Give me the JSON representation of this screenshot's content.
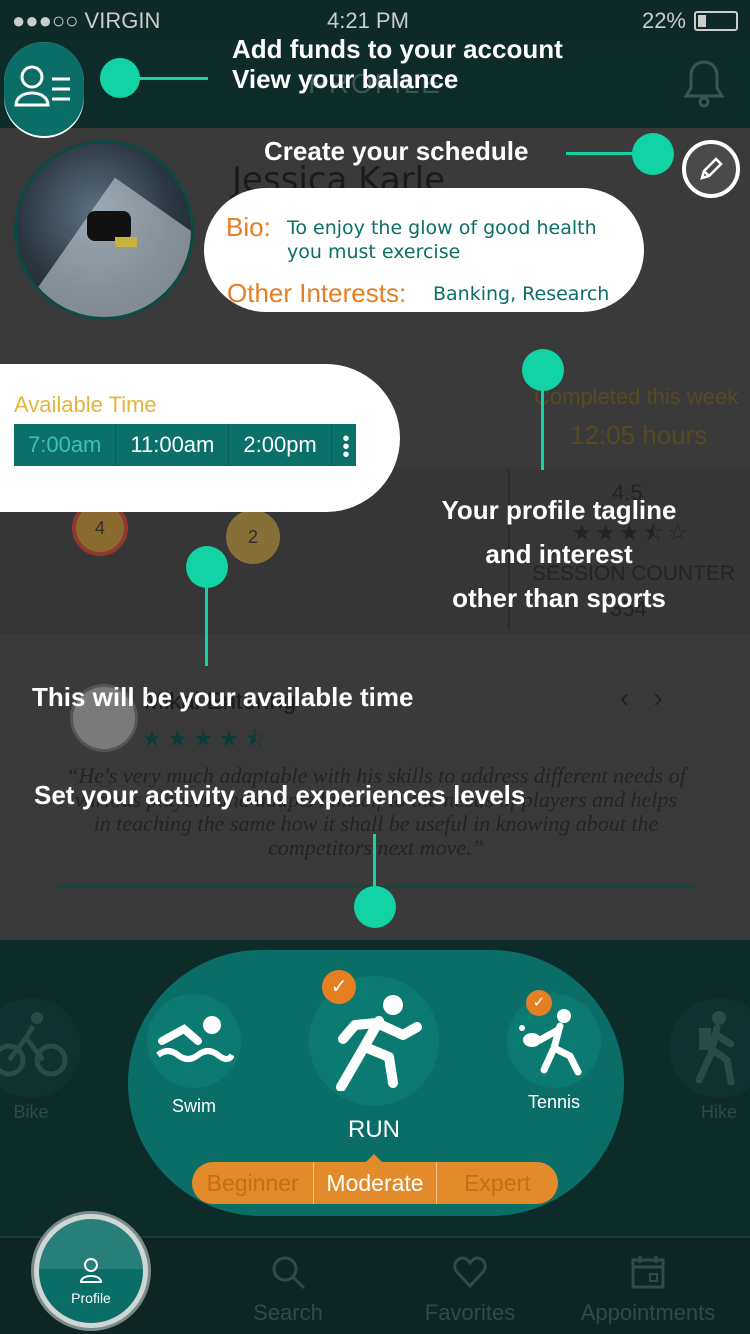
{
  "status_bar": {
    "carrier": "●●●○○ VIRGIN",
    "time": "4:21 PM",
    "battery": "22%"
  },
  "app_bar": {
    "title": "PROFILE"
  },
  "profile": {
    "name": "Jessica Karle",
    "bio_label": "Bio:",
    "bio": "To enjoy the glow of good health you must exercise",
    "interests_label": "Other Interests:",
    "interests": "Banking, Research"
  },
  "availability": {
    "label": "Available Time",
    "slots": [
      "7:00am",
      "11:00am",
      "2:00pm"
    ]
  },
  "stats": {
    "completed_label": "Completed this week",
    "completed_value": "12:05 hours",
    "rating": "4.5",
    "session_label": "SESSION COUNTER",
    "session_value": "354",
    "medal_1": "4",
    "medal_2": "2"
  },
  "review": {
    "reviewer": "Mikal Entering",
    "quote": "“He's very much adaptable with his skills to address different needs of various players and adapts himself to the needs of players and helps in teaching the same how it shall be useful in knowing about the competitors next move.”"
  },
  "activities": {
    "side_left": "Bike",
    "swim": "Swim",
    "run": "RUN",
    "tennis": "Tennis",
    "side_right": "Hike",
    "levels": [
      "Beginner",
      "Moderate",
      "Expert"
    ],
    "selected_level": "Moderate"
  },
  "tabs": {
    "profile": "Profile",
    "search": "Search",
    "favorites": "Favorites",
    "appointments": "Appointments"
  },
  "callouts": {
    "funds_line1": "Add funds to your account",
    "funds_line2": "View your balance",
    "schedule": "Create your schedule",
    "tagline_line1": "Your profile tagline",
    "tagline_line2": "and interest",
    "tagline_line3": "other than sports",
    "available_time": "This will be your available time",
    "levels": "Set your activity and experiences levels"
  },
  "colors": {
    "accent": "#11d3a4",
    "teal": "#0a6e66",
    "orange": "#e67e22",
    "overlay": "#3a3a3a"
  },
  "icons": [
    "profile-menu-icon",
    "bell-icon",
    "pencil-icon",
    "swim-icon",
    "run-icon",
    "tennis-icon",
    "bike-icon",
    "hike-icon",
    "search-icon",
    "heart-icon",
    "calendar-icon",
    "user-icon"
  ]
}
